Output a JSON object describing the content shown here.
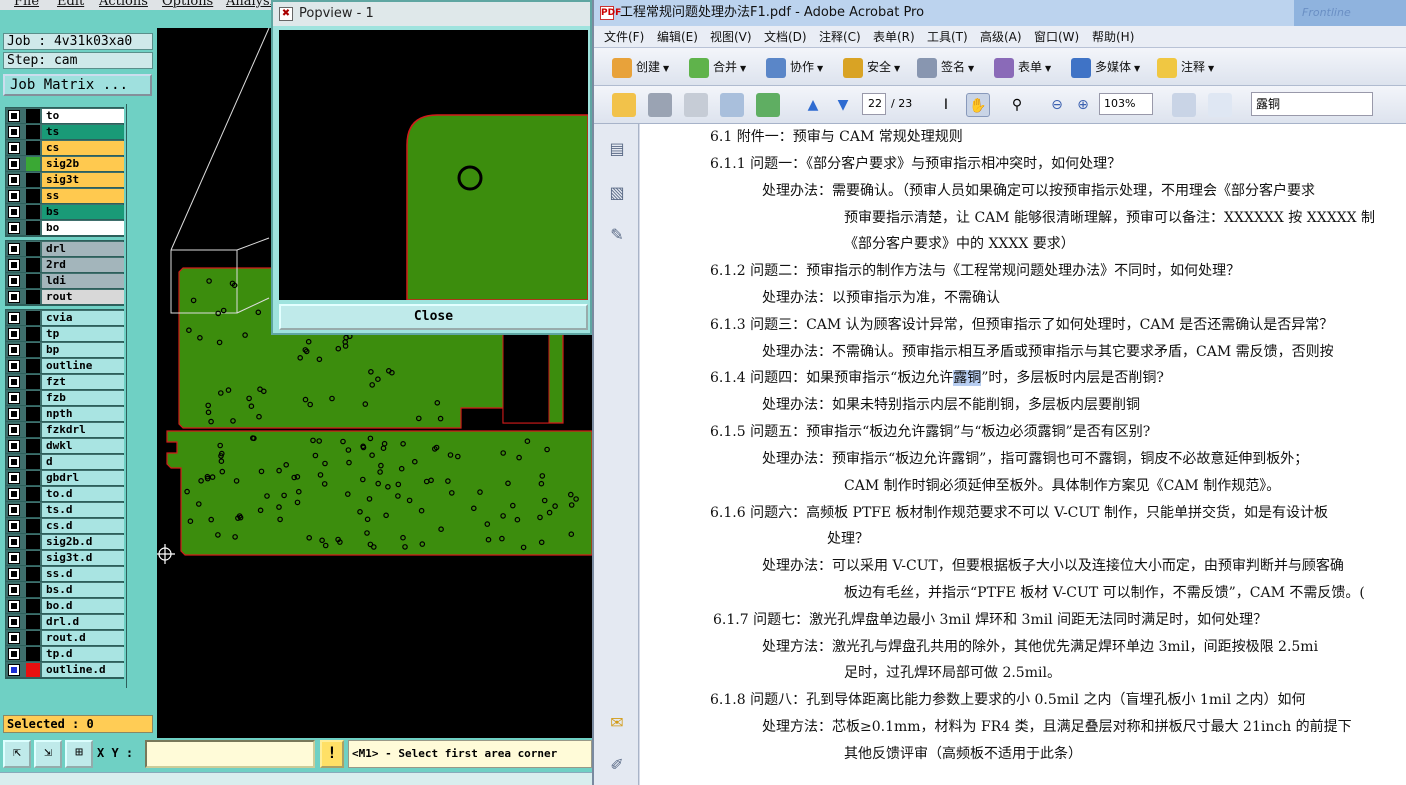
{
  "cam": {
    "menu": [
      "File",
      "Edit",
      "Actions",
      "Options",
      "Analysis"
    ],
    "job": "Job : 4v31k03xa0",
    "step": "Step: cam",
    "job_matrix": "Job Matrix ...",
    "layers_board": [
      {
        "name": "to",
        "color": "#ffffff"
      },
      {
        "name": "ts",
        "color": "#199a77"
      },
      {
        "name": "cs",
        "color": "#ffc94f"
      },
      {
        "name": "sig2b",
        "color": "#ffc94f",
        "swatch": "#3aa834"
      },
      {
        "name": "sig3t",
        "color": "#ffc94f"
      },
      {
        "name": "ss",
        "color": "#ffc94f"
      },
      {
        "name": "bs",
        "color": "#199a77"
      },
      {
        "name": "bo",
        "color": "#ffffff"
      }
    ],
    "layers_drill": [
      {
        "name": "drl",
        "color": "#a3b5bb"
      },
      {
        "name": "2rd",
        "color": "#a3b5bb"
      },
      {
        "name": "ldi",
        "color": "#a3b5bb"
      },
      {
        "name": "rout",
        "color": "#d8d8d8"
      }
    ],
    "layers_misc": [
      {
        "name": "cvia"
      },
      {
        "name": "tp"
      },
      {
        "name": "bp"
      },
      {
        "name": "outline"
      },
      {
        "name": "fzt"
      },
      {
        "name": "fzb"
      },
      {
        "name": "npth"
      },
      {
        "name": "fzkdrl"
      },
      {
        "name": "dwkl"
      },
      {
        "name": "d"
      },
      {
        "name": "gbdrl"
      },
      {
        "name": "to.d"
      },
      {
        "name": "ts.d"
      },
      {
        "name": "cs.d"
      },
      {
        "name": "sig2b.d"
      },
      {
        "name": "sig3t.d"
      },
      {
        "name": "ss.d"
      },
      {
        "name": "bs.d"
      },
      {
        "name": "bo.d"
      },
      {
        "name": "drl.d"
      },
      {
        "name": "rout.d"
      },
      {
        "name": "tp.d"
      },
      {
        "name": "outline.d",
        "swatch": "#e81010",
        "active": true
      }
    ],
    "selected": "Selected : 0",
    "xy_label": "X Y :",
    "xy_value": "",
    "excl": "!",
    "status_msg": "<M1> - Select first area corner",
    "board_color": "#3c8d0d",
    "board_outline_color": "#d21b1b"
  },
  "popview": {
    "title": "Popview - 1",
    "close_label": "Close"
  },
  "acrobat": {
    "title": "工程常规问题处理办法F1.pdf - Adobe Acrobat Pro",
    "brand": "Frontline",
    "menu": [
      "文件(F)",
      "编辑(E)",
      "视图(V)",
      "文档(D)",
      "注释(C)",
      "表单(R)",
      "工具(T)",
      "高级(A)",
      "窗口(W)",
      "帮助(H)"
    ],
    "toolbar1": [
      "创建",
      "合并",
      "协作",
      "安全",
      "签名",
      "表单",
      "多媒体",
      "注释"
    ],
    "page_current": "22",
    "page_total": "/ 23",
    "zoom": "103%",
    "search": "露铜",
    "doc_lines": [
      "6.1  附件一：预审与 CAM 常规处理规则",
      "6.1.1  问题一：《部分客户要求》与预审指示相冲突时，如何处理？",
      "处理办法：需要确认。（预审人员如果确定可以按预审指示处理，不用理会《部分客户要求",
      "预审要指示清楚，让 CAM 能够很清晰理解，预审可以备注：XXXXXX 按 XXXXX 制",
      "《部分客户要求》中的 XXXX 要求）",
      "6.1.2  问题二：预审指示的制作方法与《工程常规问题处理办法》不同时，如何处理？",
      "处理办法：以预审指示为准，不需确认",
      "6.1.3  问题三：CAM 认为顾客设计异常，但预审指示了如何处理时，CAM 是否还需确认是否异常？",
      "处理办法：不需确认。预审指示相互矛盾或预审指示与其它要求矛盾，CAM 需反馈，否则按",
      "6.1.4  问题四：如果预审指示“板边允许",
      "露铜",
      "”时，多层板时内层是否削铜?",
      "处理办法：如果未特别指示内层不能削铜，多层板内层要削铜",
      "6.1.5  问题五：预审指示“板边允许露铜”与“板边必须露铜”是否有区别?",
      "处理办法：预审指示“板边允许露铜”，指可露铜也可不露铜，铜皮不必故意延伸到板外；",
      "CAM 制作时铜必须延伸至板外。具体制作方案见《CAM 制作规范》。",
      "6.1.6  问题六：高频板 PTFE 板材制作规范要求不可以 V-CUT 制作，只能单拼交货，如是有设计板",
      "处理？",
      "处理办法：可以采用 V-CUT，但要根据板子大小以及连接位大小而定，由预审判断并与顾客确",
      "板边有毛丝，并指示“PTFE 板材 V-CUT 可以制作，不需反馈”，CAM 不需反馈。(",
      "6.1.7  问题七：激光孔焊盘单边最小 3mil 焊环和 3mil 间距无法同时满足时，如何处理？",
      "处理方法：激光孔与焊盘孔共用的除外，其他优先满足焊环单边 3mil，间距按极限 2.5mi",
      "足时，过孔焊环局部可做 2.5mil。",
      "6.1.8  问题八：孔到导体距离比能力参数上要求的小 0.5mil 之内（盲埋孔板小 1mil 之内）如何",
      "处理方法：芯板≥0.1mm，材料为 FR4 类，且满足叠层对称和拼板尺寸最大 21inch 的前提下",
      "其他反馈评审（高频板不适用于此条）"
    ]
  }
}
